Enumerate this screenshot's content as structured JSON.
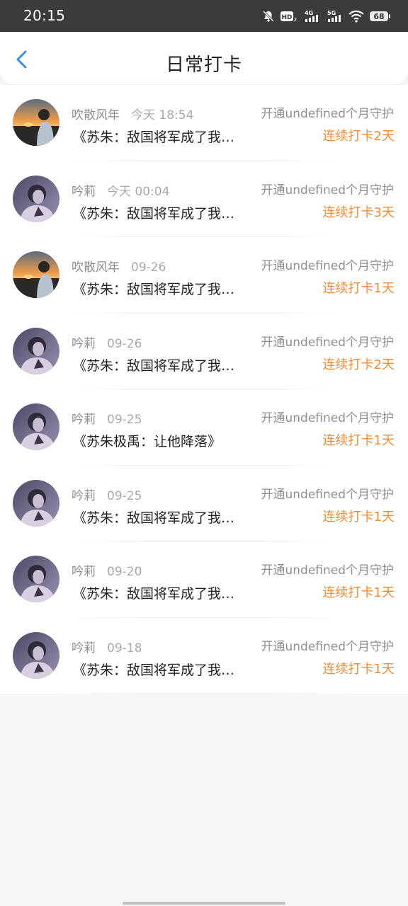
{
  "status_bar": {
    "time": "20:15",
    "icons": [
      "mute-bell-icon",
      "hd-icon",
      "4g-signal-icon",
      "5g-signal-icon",
      "wifi-icon",
      "battery-icon"
    ],
    "battery_level": "68"
  },
  "header": {
    "title": "日常打卡",
    "back_icon": "chevron-left-icon"
  },
  "colors": {
    "accent": "#3d8fe0",
    "streak": "#f08b3a",
    "muted_text": "#9a9a9a",
    "title_text": "#222222"
  },
  "records": [
    {
      "name": "吹散风年",
      "date": "今天  18:54",
      "guard": "开通undefined个月守护",
      "book": "《苏朱：敌国将军成了我的俘虏》",
      "streak": "连续打卡2天",
      "avatar": "sunset"
    },
    {
      "name": "吟莉",
      "date": "今天  00:04",
      "guard": "开通undefined个月守护",
      "book": "《苏朱：敌国将军成了我的俘虏》",
      "streak": "连续打卡3天",
      "avatar": "purple"
    },
    {
      "name": "吹散风年",
      "date": "09-26",
      "guard": "开通undefined个月守护",
      "book": "《苏朱：敌国将军成了我的俘虏》",
      "streak": "连续打卡1天",
      "avatar": "sunset"
    },
    {
      "name": "吟莉",
      "date": "09-26",
      "guard": "开通undefined个月守护",
      "book": "《苏朱：敌国将军成了我的俘虏》",
      "streak": "连续打卡2天",
      "avatar": "purple"
    },
    {
      "name": "吟莉",
      "date": "09-25",
      "guard": "开通undefined个月守护",
      "book": "《苏朱极禹：让他降落》",
      "streak": "连续打卡1天",
      "avatar": "purple"
    },
    {
      "name": "吟莉",
      "date": "09-25",
      "guard": "开通undefined个月守护",
      "book": "《苏朱：敌国将军成了我的俘虏》",
      "streak": "连续打卡1天",
      "avatar": "purple"
    },
    {
      "name": "吟莉",
      "date": "09-20",
      "guard": "开通undefined个月守护",
      "book": "《苏朱：敌国将军成了我的俘虏》",
      "streak": "连续打卡1天",
      "avatar": "purple"
    },
    {
      "name": "吟莉",
      "date": "09-18",
      "guard": "开通undefined个月守护",
      "book": "《苏朱：敌国将军成了我的俘虏》",
      "streak": "连续打卡1天",
      "avatar": "purple"
    }
  ]
}
